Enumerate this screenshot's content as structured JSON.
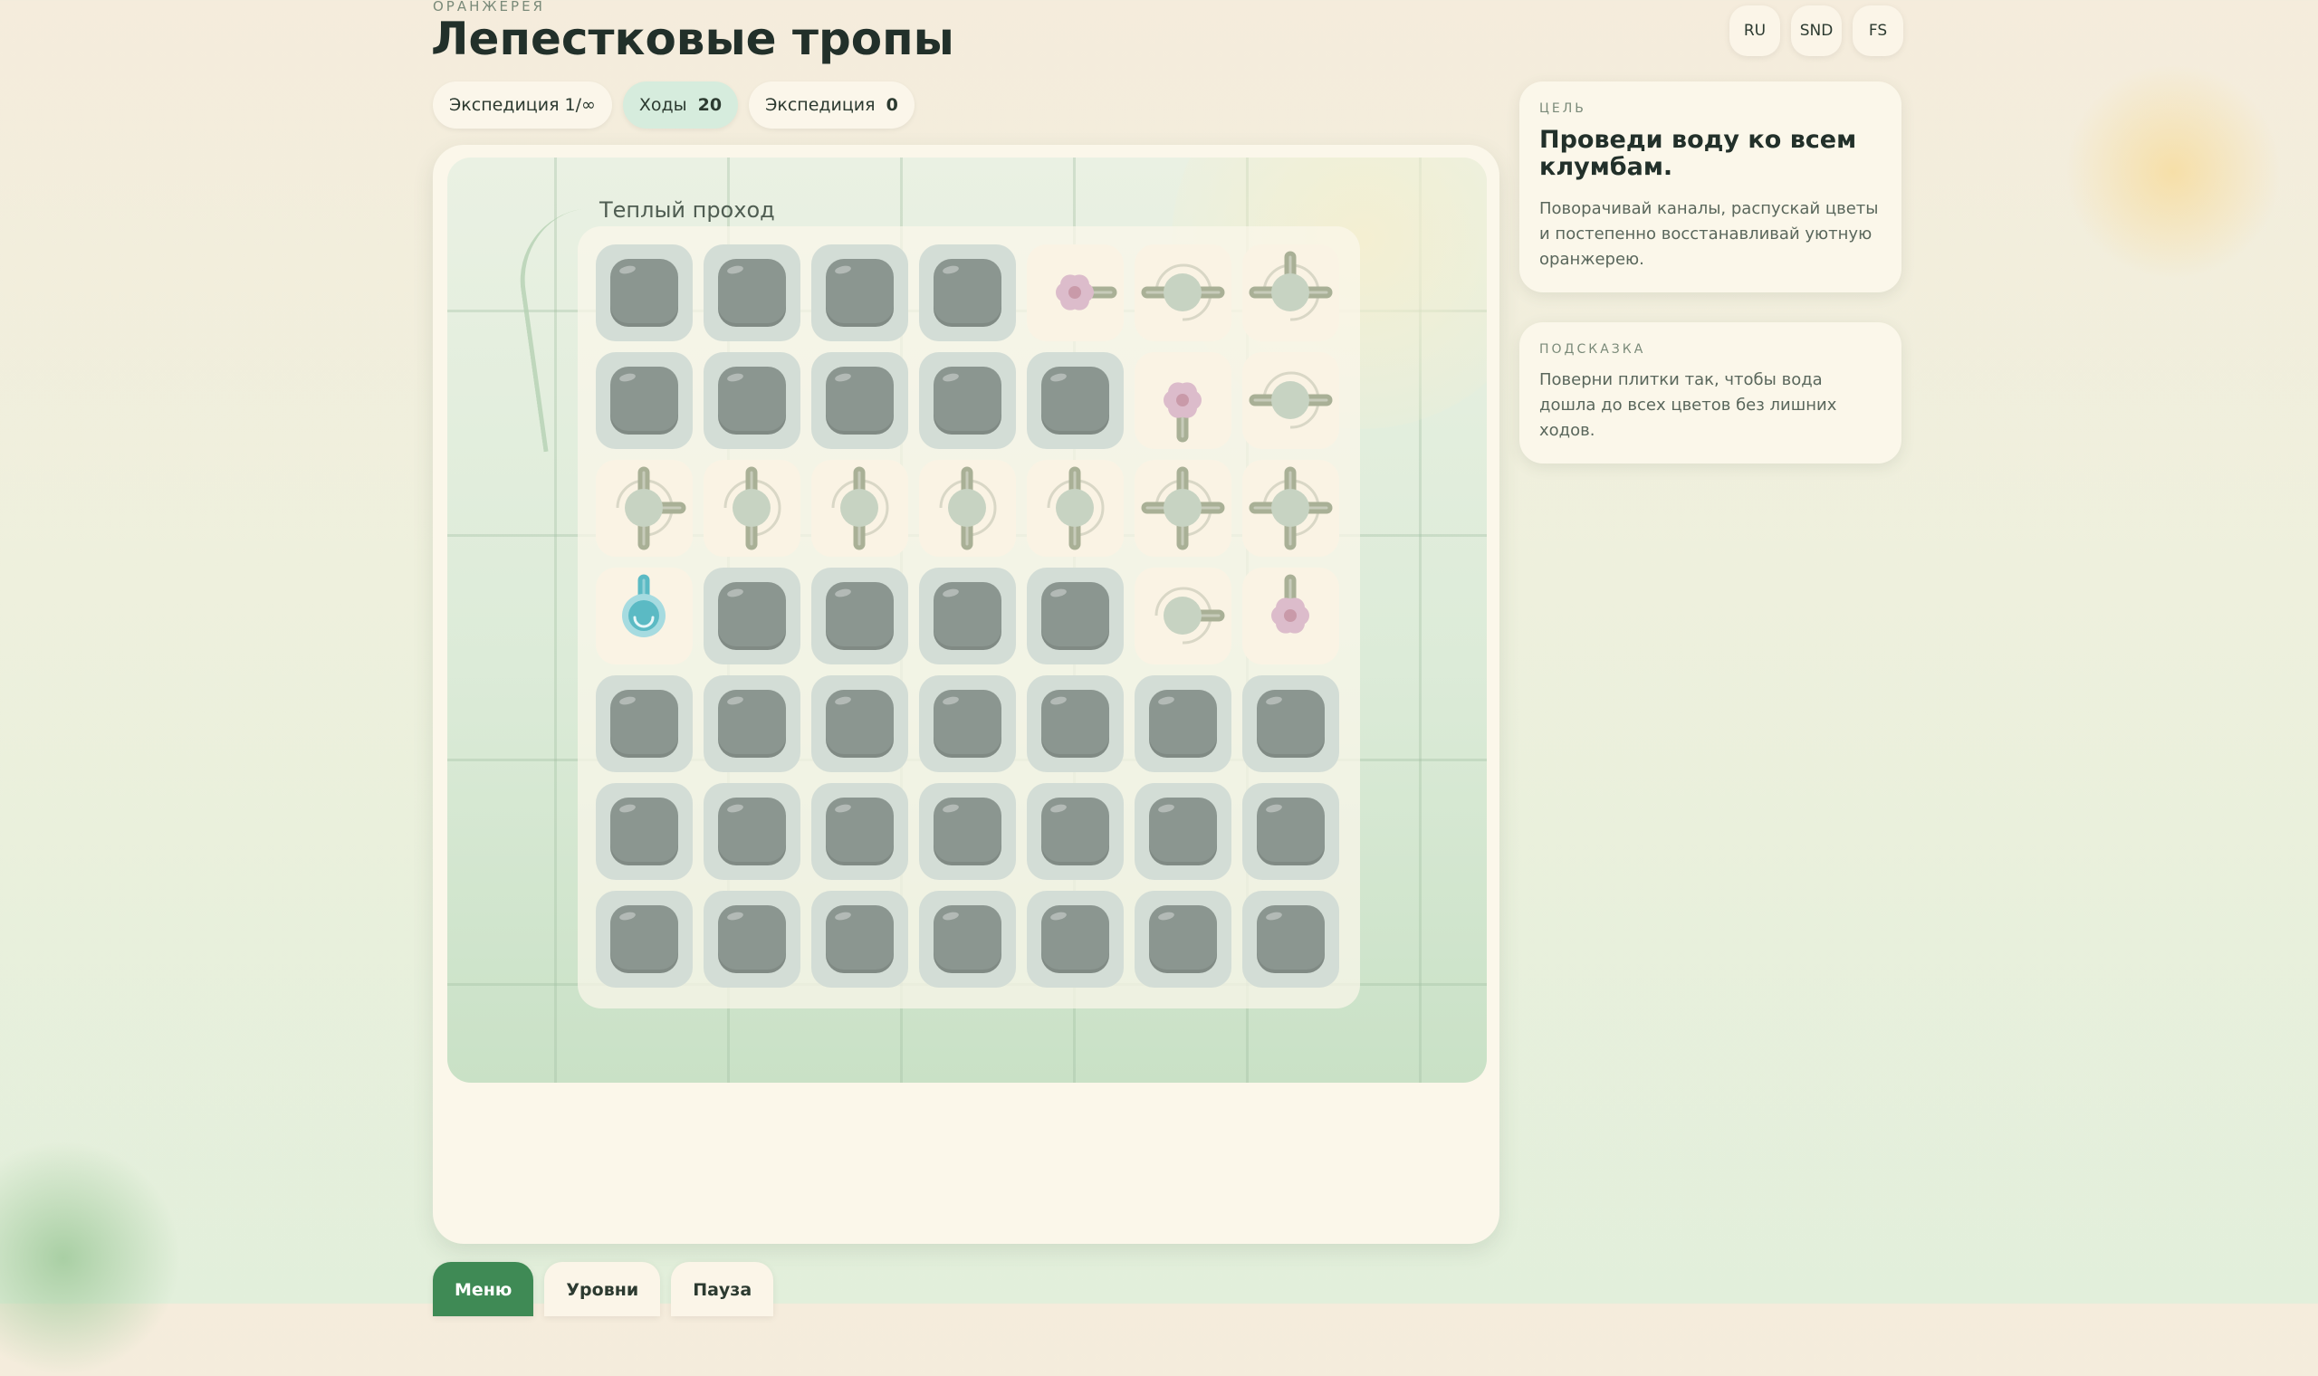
{
  "header": {
    "overline": "ОРАНЖЕРЕЯ",
    "title": "Лепестковые тропы"
  },
  "chips": [
    {
      "label": "Экспедиция 1/∞",
      "value": ""
    },
    {
      "label": "Ходы",
      "value": "20"
    },
    {
      "label": "Экспедиция",
      "value": "0"
    }
  ],
  "top_buttons": {
    "lang": "RU",
    "sound": "SND",
    "fullscreen": "FS"
  },
  "level": {
    "name": "Теплый проход"
  },
  "board": {
    "rows": 7,
    "cols": 7,
    "tiles": [
      [
        "rock",
        "rock",
        "rock",
        "rock",
        "flower-e",
        "cross-ew",
        "tee-new"
      ],
      [
        "rock",
        "rock",
        "rock",
        "rock",
        "rock",
        "flower-s",
        "pipe-ew"
      ],
      [
        "tee-nse",
        "pipe-ns",
        "pipe-ns",
        "pipe-ns",
        "pipe-ns",
        "cross",
        "cross"
      ],
      [
        "source-n",
        "rock",
        "rock",
        "rock",
        "rock",
        "end-e",
        "flower-n"
      ],
      [
        "rock",
        "rock",
        "rock",
        "rock",
        "rock",
        "rock",
        "rock"
      ],
      [
        "rock",
        "rock",
        "rock",
        "rock",
        "rock",
        "rock",
        "rock"
      ],
      [
        "rock",
        "rock",
        "rock",
        "rock",
        "rock",
        "rock",
        "rock"
      ]
    ]
  },
  "goal": {
    "label": "ЦЕЛЬ",
    "heading": "Проведи воду ко всем клумбам.",
    "text": "Поворачивай каналы, распускай цветы и постепенно восстанавливай уютную оранжерею."
  },
  "hint": {
    "label": "ПОДСКАЗКА",
    "text": "Поверни плитки так, чтобы вода дошла до всех цветов без лишних ходов."
  },
  "bottom_tabs": {
    "menu": "Меню",
    "levels": "Уровни",
    "pause": "Пауза"
  },
  "colors": {
    "accent": "#3f8a55",
    "stone": "#8b9690",
    "pipe": "#a9b096",
    "water": "#5bbac4",
    "flower": "#dcbccb"
  }
}
